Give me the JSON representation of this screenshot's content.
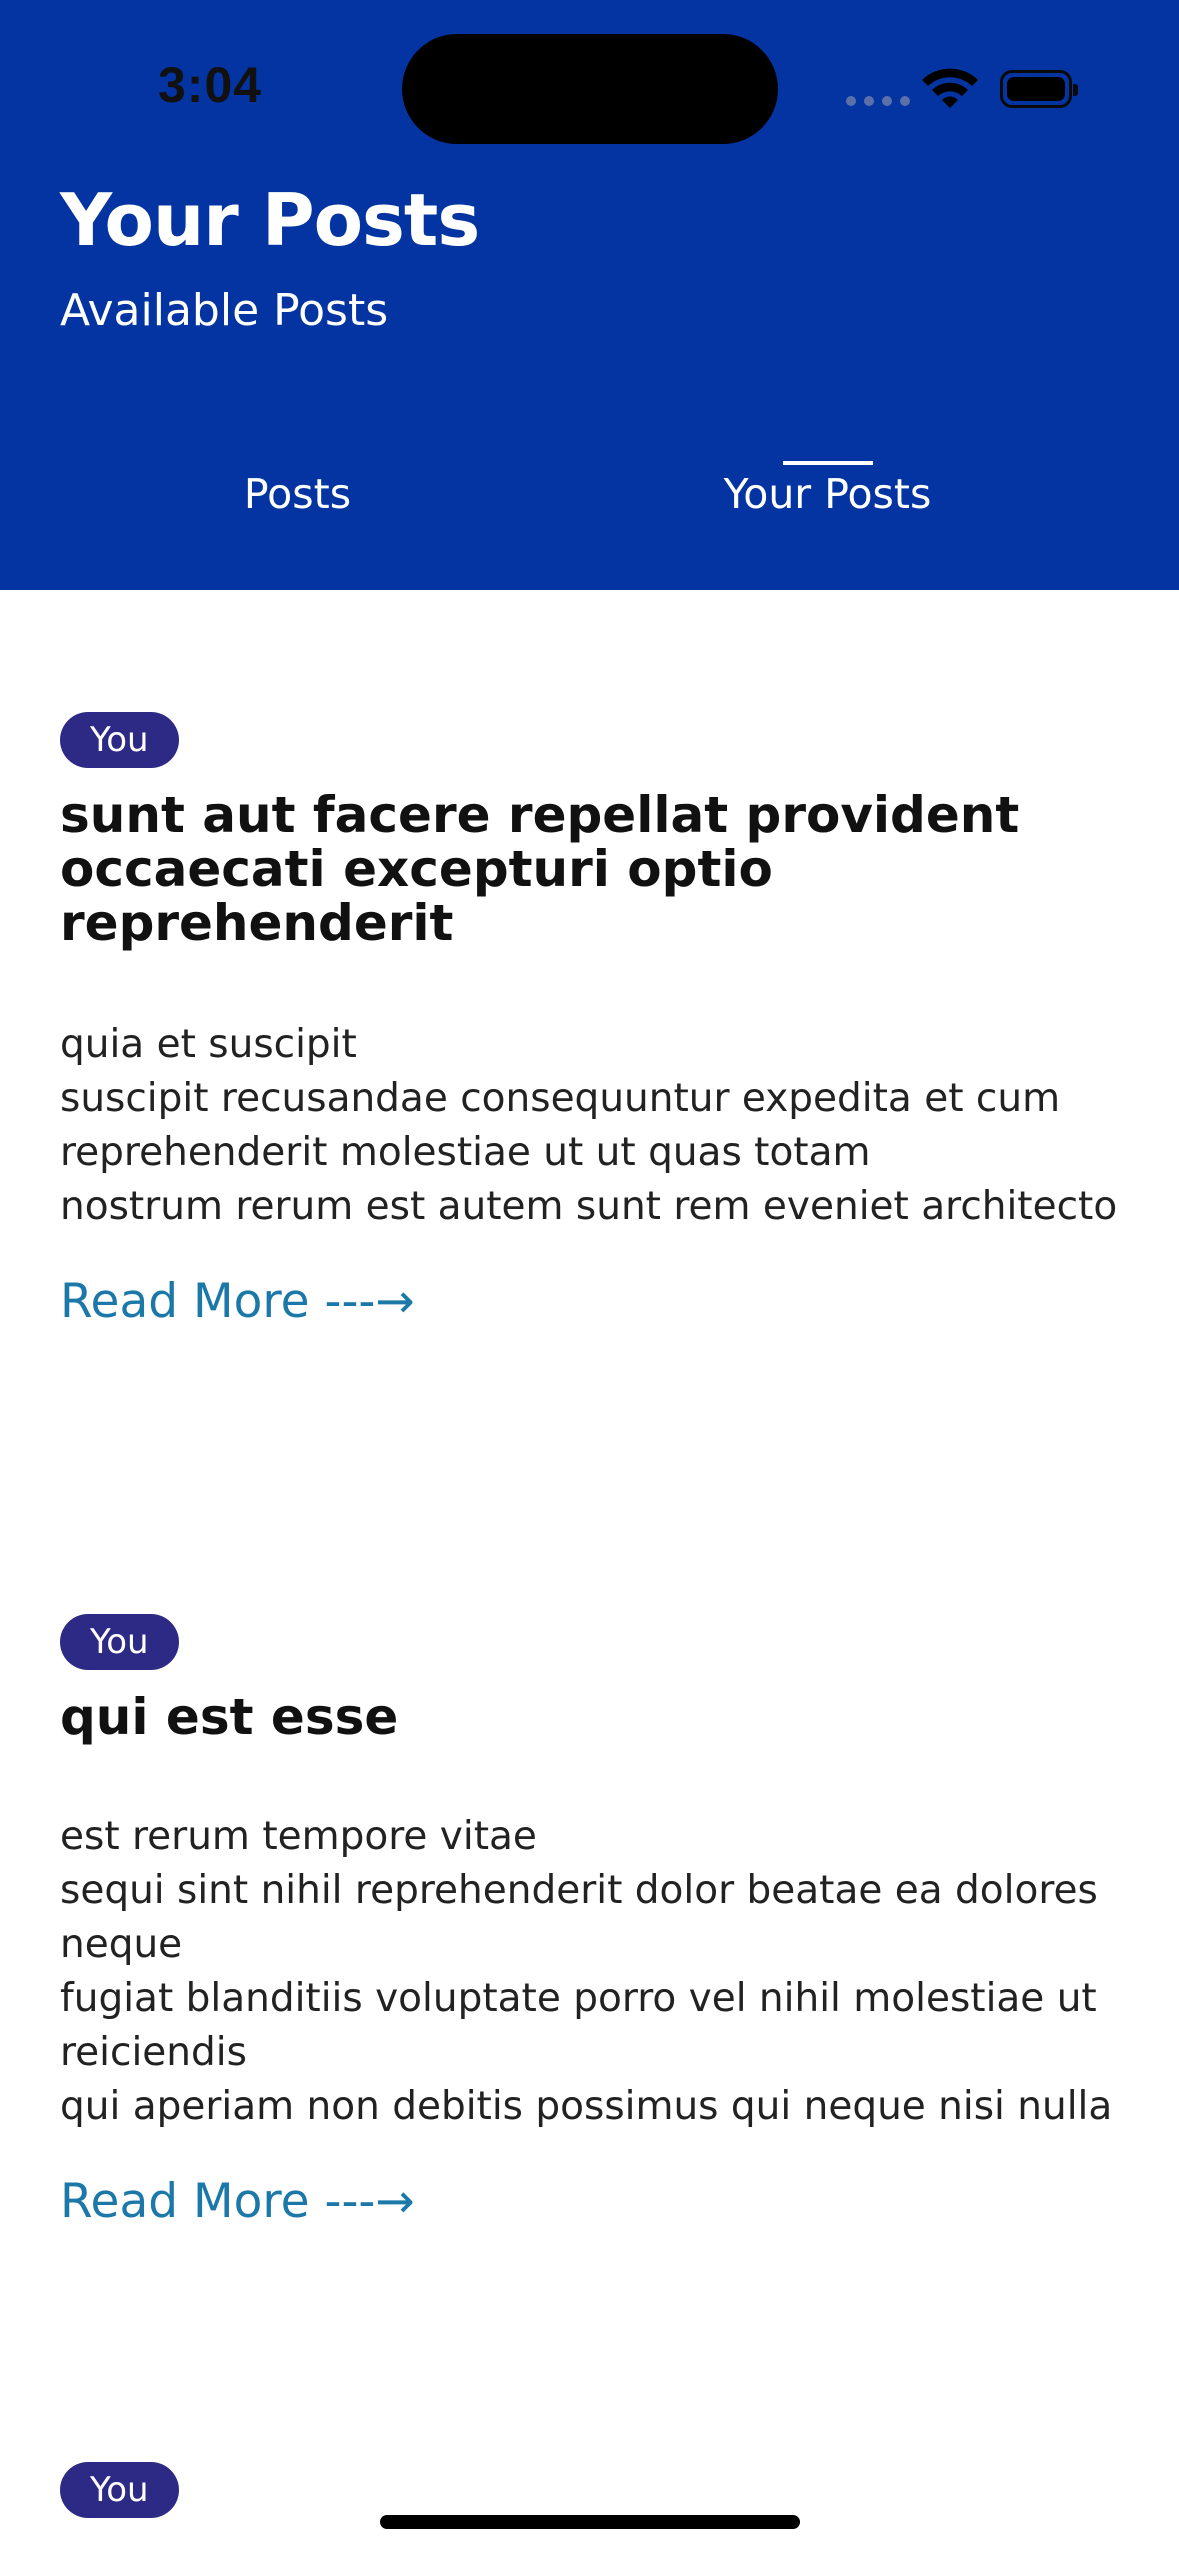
{
  "status_bar": {
    "time": "3:04"
  },
  "header": {
    "title": "Your Posts",
    "subtitle": "Available Posts",
    "tabs": [
      {
        "label": "Posts",
        "active": false
      },
      {
        "label": "Your Posts",
        "active": true
      }
    ]
  },
  "posts": [
    {
      "badge": "You",
      "title": "sunt aut facere repellat provident occaecati excepturi optio reprehenderit",
      "body": "quia et suscipit\nsuscipit recusandae consequuntur expedita et cum\nreprehenderit molestiae ut ut quas totam\nnostrum rerum est autem sunt rem eveniet architecto",
      "read_more": "Read More ---→"
    },
    {
      "badge": "You",
      "title": "qui est esse",
      "body": "est rerum tempore vitae\nsequi sint nihil reprehenderit dolor beatae ea dolores neque\nfugiat blanditiis voluptate porro vel nihil molestiae ut reiciendis\nqui aperiam non debitis possimus qui neque nisi nulla",
      "read_more": "Read More ---→"
    },
    {
      "badge": "You"
    }
  ],
  "colors": {
    "header_bg": "#0434a1",
    "badge_bg": "#2d2a86",
    "link": "#1b78a8"
  }
}
